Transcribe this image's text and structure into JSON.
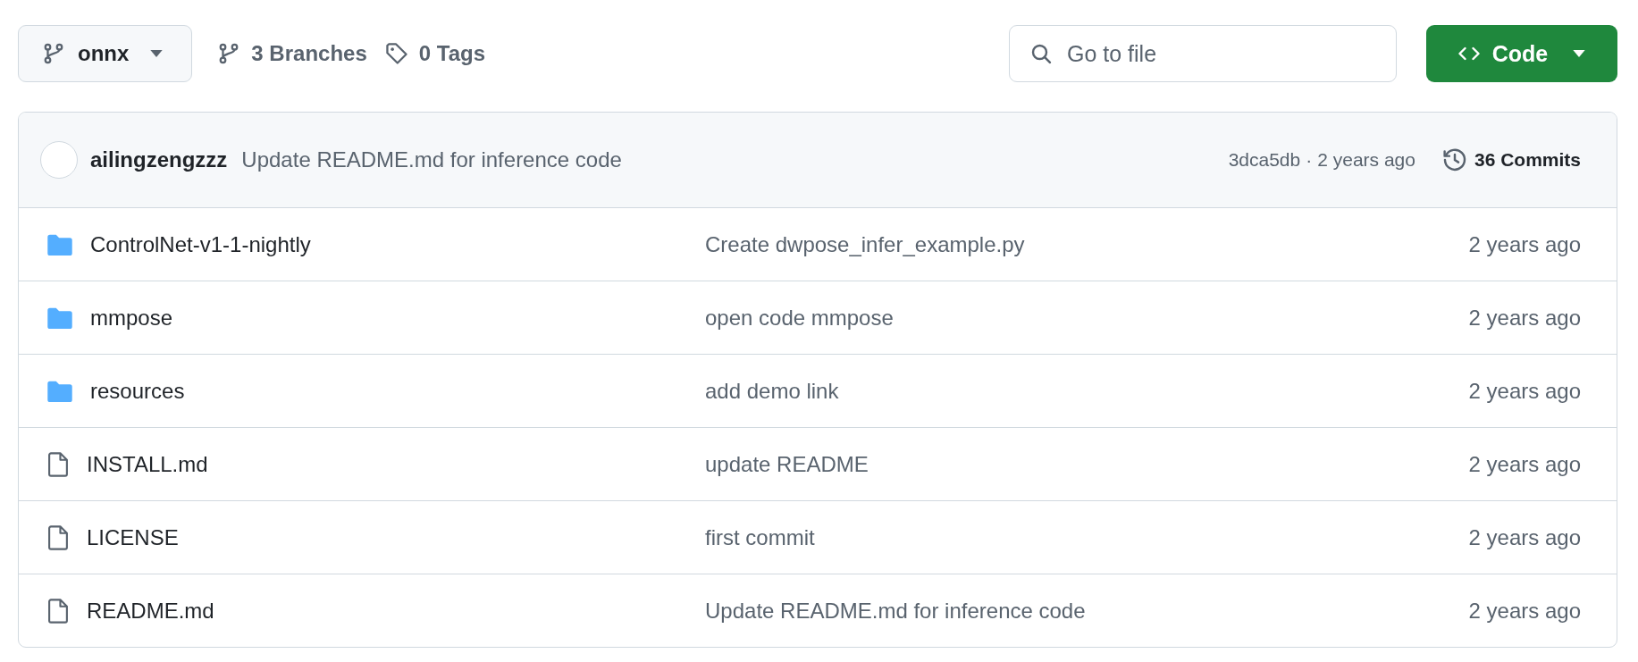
{
  "branch_selector": {
    "label": "onnx"
  },
  "branches_link": "**3** Branches",
  "tags_link": "**0** Tags",
  "search": {
    "placeholder": "Go to file"
  },
  "code_button": {
    "label": "Code"
  },
  "latest_commit": {
    "author": "ailingzengzzz",
    "message": "Update README.md for inference code",
    "hash": "3dca5db",
    "separator": "·",
    "time": "2 years ago",
    "commits": "36 Commits"
  },
  "files": [
    {
      "kind": "folder",
      "name": "ControlNet-v1-1-nightly",
      "message": "Create dwpose_infer_example.py",
      "time": "2 years ago"
    },
    {
      "kind": "folder",
      "name": "mmpose",
      "message": "open code mmpose",
      "time": "2 years ago"
    },
    {
      "kind": "folder",
      "name": "resources",
      "message": "add demo link",
      "time": "2 years ago"
    },
    {
      "kind": "file",
      "name": "INSTALL.md",
      "message": "update README",
      "time": "2 years ago"
    },
    {
      "kind": "file",
      "name": "LICENSE",
      "message": "first commit",
      "time": "2 years ago"
    },
    {
      "kind": "file",
      "name": "README.md",
      "message": "Update README.md for inference code",
      "time": "2 years ago"
    }
  ]
}
